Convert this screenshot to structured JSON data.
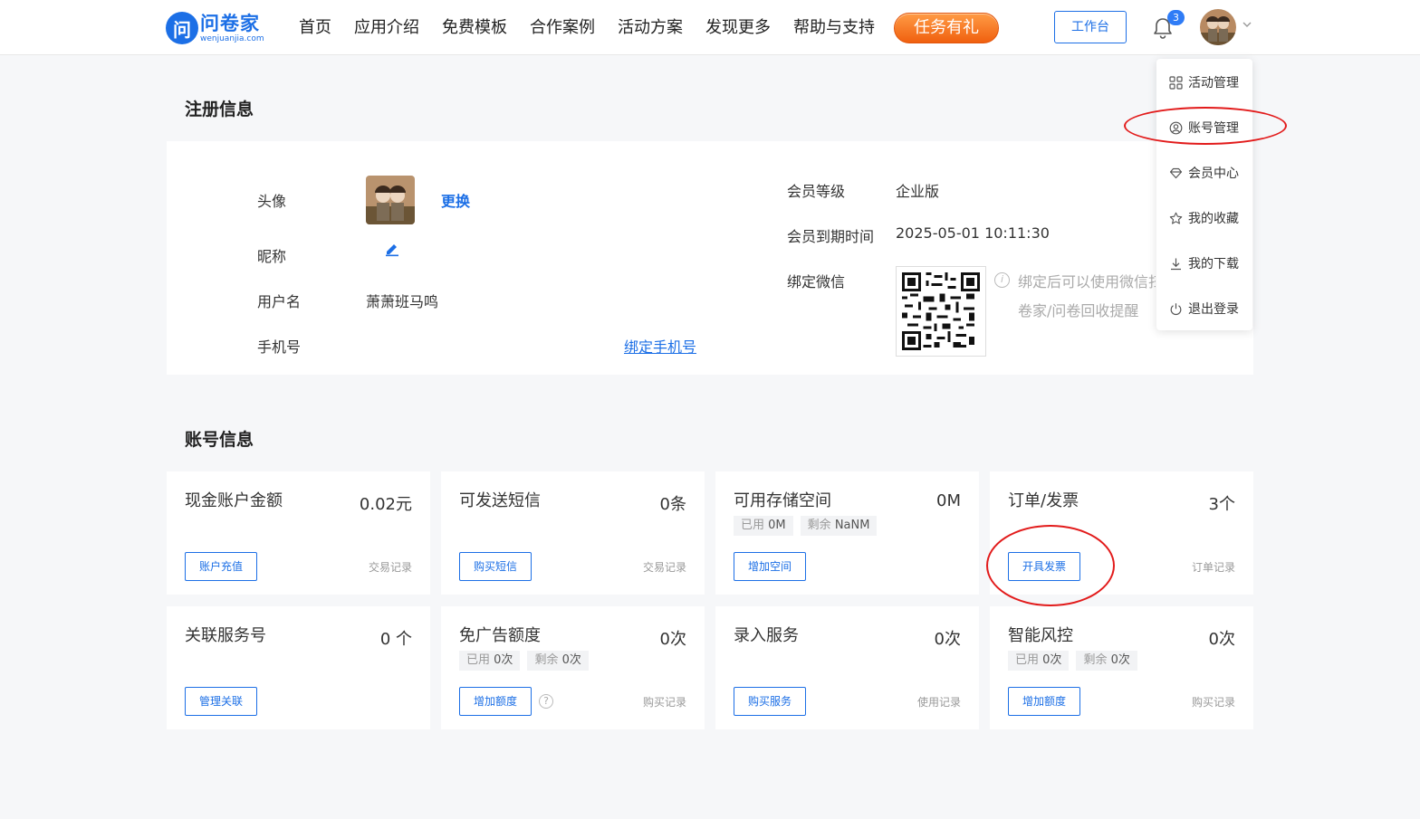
{
  "brand": {
    "logo_mark": "问",
    "name": "问卷家",
    "domain": "wenjuanjia.com"
  },
  "nav": [
    "首页",
    "应用介绍",
    "免费模板",
    "合作案例",
    "活动方案",
    "发现更多",
    "帮助与支持"
  ],
  "header": {
    "promo_label": "任务有礼",
    "workbench_label": "工作台",
    "notification_count": "3"
  },
  "dropdown": [
    {
      "label": "活动管理",
      "icon": "grid-icon"
    },
    {
      "label": "账号管理",
      "icon": "user-circle-icon"
    },
    {
      "label": "会员中心",
      "icon": "diamond-icon"
    },
    {
      "label": "我的收藏",
      "icon": "star-icon"
    },
    {
      "label": "我的下载",
      "icon": "download-icon"
    },
    {
      "label": "退出登录",
      "icon": "power-icon"
    }
  ],
  "registration": {
    "title": "注册信息",
    "avatar_label": "头像",
    "change_label": "更换",
    "nickname_label": "昵称",
    "username_label": "用户名",
    "username_value": "萧萧班马鸣",
    "phone_label": "手机号",
    "bind_phone_label": "绑定手机号",
    "member_level_label": "会员等级",
    "member_level_value": "企业版",
    "expire_label": "会员到期时间",
    "expire_value": "2025-05-01 10:11:30",
    "wechat_label": "绑定微信",
    "wechat_hint_line1": "绑定后可以使用微信扫",
    "wechat_hint_line2": "卷家/问卷回收提醒"
  },
  "account": {
    "title": "账号信息",
    "cards": [
      {
        "title": "现金账户金额",
        "value": "0.02元",
        "button": "账户充值",
        "link": "交易记录"
      },
      {
        "title": "可发送短信",
        "value": "0条",
        "button": "购买短信",
        "link": "交易记录"
      },
      {
        "title": "可用存储空间",
        "value": "0M",
        "button": "增加空间",
        "link": "",
        "chip1_label": "已用",
        "chip1_value": "0M",
        "chip2_label": "剩余",
        "chip2_value": "NaNM"
      },
      {
        "title": "订单/发票",
        "value": "3个",
        "button": "开具发票",
        "link": "订单记录"
      },
      {
        "title": "关联服务号",
        "value": "0 个",
        "button": "管理关联",
        "link": ""
      },
      {
        "title": "免广告额度",
        "value": "0次",
        "button": "增加额度",
        "link": "购买记录",
        "chip1_label": "已用",
        "chip1_value": "0次",
        "chip2_label": "剩余",
        "chip2_value": "0次"
      },
      {
        "title": "录入服务",
        "value": "0次",
        "button": "购买服务",
        "link": "使用记录"
      },
      {
        "title": "智能风控",
        "value": "0次",
        "button": "增加额度",
        "link": "购买记录",
        "chip1_label": "已用",
        "chip1_value": "0次",
        "chip2_label": "剩余",
        "chip2_value": "0次"
      }
    ]
  },
  "colors": {
    "accent": "#1c6fe6",
    "promo": "#f0600f",
    "annotation": "#e21b1b"
  }
}
